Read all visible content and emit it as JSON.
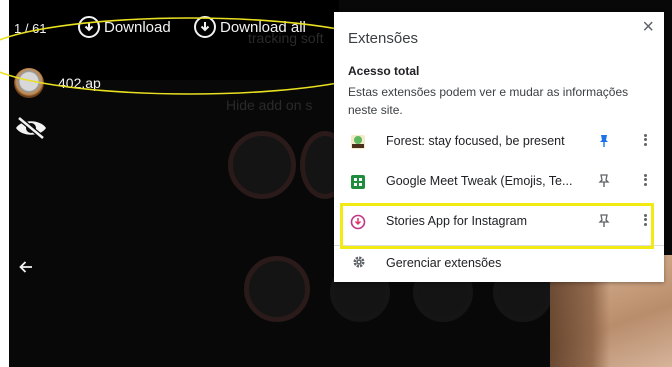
{
  "viewer": {
    "story_counter": "1 / 61",
    "download_label": "Download",
    "download_all_label": "Download all",
    "username": "402.ap",
    "background_hint_text": "Hide add on s",
    "background_hint_text2": "tracking soft"
  },
  "popup": {
    "title": "Extensões",
    "close_glyph": "×",
    "section_title": "Acesso total",
    "section_desc": "Estas extensões podem ver e mudar as informações neste site.",
    "extensions": [
      {
        "name": "Forest: stay focused, be present",
        "icon": "forest-icon",
        "pinned": true
      },
      {
        "name": "Google Meet Tweak (Emojis, Te...",
        "icon": "meet-tweak-icon",
        "pinned": false
      },
      {
        "name": "Stories App for Instagram",
        "icon": "stories-app-icon",
        "pinned": false
      }
    ],
    "manage_label": "Gerenciar extensões"
  },
  "colors": {
    "pinned_blue": "#1a73e8",
    "unpinned_gray": "#5f6368",
    "highlight_yellow": "#f2ea13",
    "annotation_yellow": "#e8e020"
  }
}
